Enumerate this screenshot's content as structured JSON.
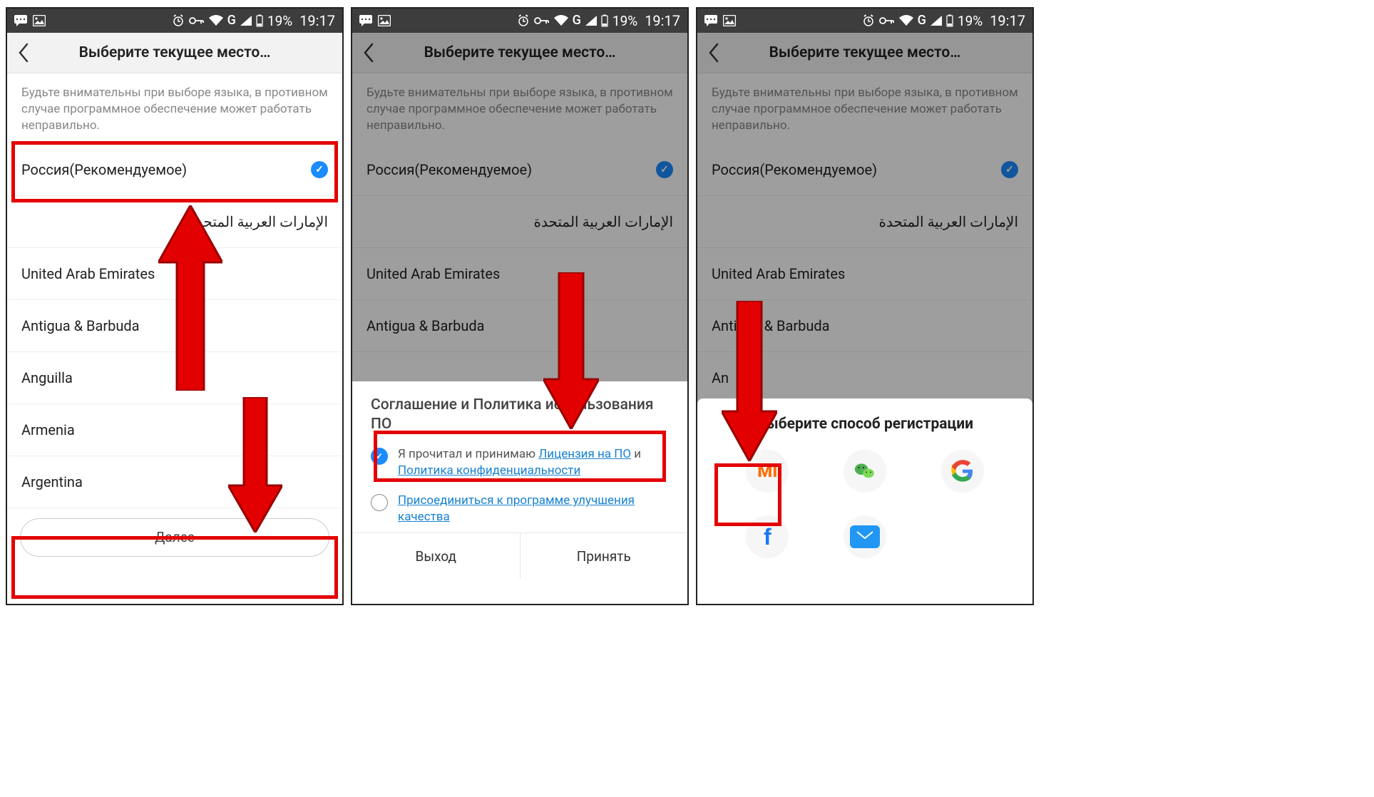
{
  "statusbar": {
    "battery": "19%",
    "time": "19:17",
    "network_letter": "G"
  },
  "header": {
    "title": "Выберите текущее место…"
  },
  "advisory": "Будьте внимательны при выборе языка, в противном случае программное обеспечение может работать неправильно.",
  "list": {
    "recommended": "Россия(Рекомендуемое)",
    "items": [
      "الإمارات العربية المتحدة",
      "United Arab Emirates",
      "Antigua & Barbuda",
      "Anguilla",
      "Armenia",
      "Argentina"
    ]
  },
  "next_label": "Далее",
  "agreement": {
    "title": "Соглашение и Политика использования ПО",
    "accept_prefix": "Я прочитал и принимаю ",
    "license_link": "Лицензия на ПО",
    "and": " и ",
    "privacy_link": "Политика конфиденциальности",
    "improve_link": "Присоединиться к программе улучшения качества",
    "exit": "Выход",
    "accept": "Принять"
  },
  "register": {
    "title": "Выберите способ регистрации",
    "mi": "MI",
    "fb_letter": "f"
  },
  "panel3_anguilla_cut": "An"
}
